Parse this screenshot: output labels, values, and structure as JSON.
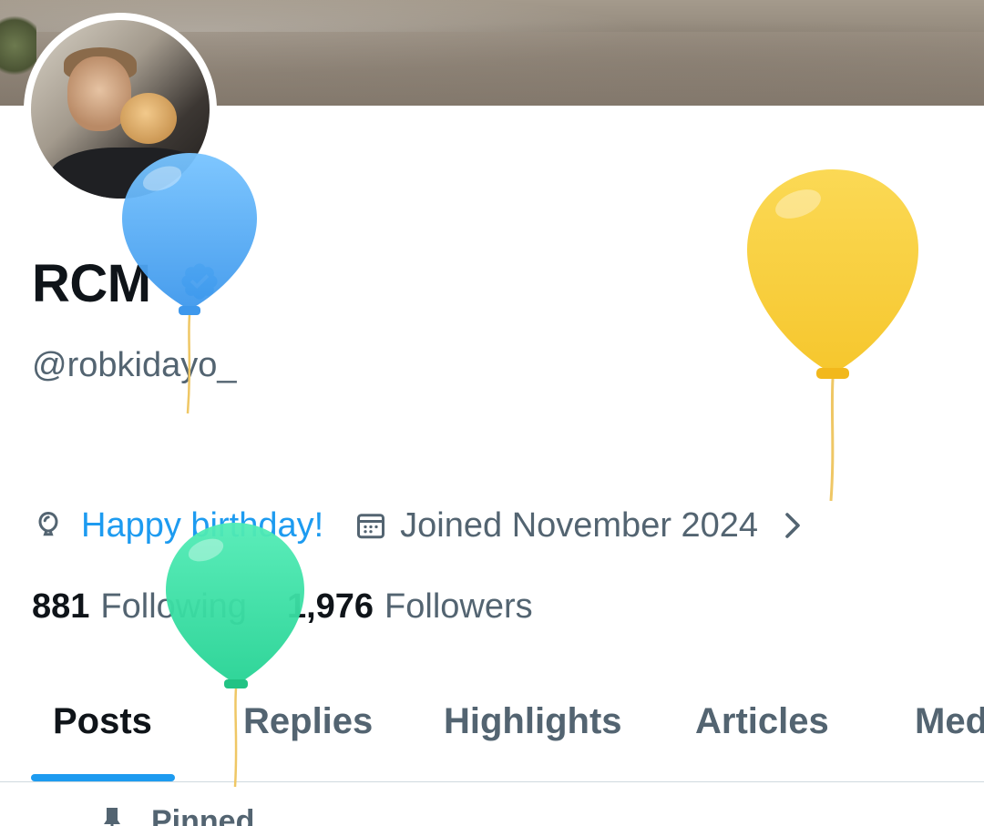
{
  "profile": {
    "display_name": "RCM",
    "handle": "@robkidayo_",
    "verified_icon": "verified-badge-icon",
    "birthday_text": "Happy birthday!",
    "joined_text": "Joined November 2024",
    "following_count": "881",
    "following_label": "Following",
    "followers_count": "1,976",
    "followers_label": "Followers"
  },
  "tabs": [
    {
      "label": "Posts",
      "active": true
    },
    {
      "label": "Replies",
      "active": false
    },
    {
      "label": "Highlights",
      "active": false
    },
    {
      "label": "Articles",
      "active": false
    },
    {
      "label": "Med",
      "active": false
    }
  ],
  "pinned_label": "Pinned",
  "colors": {
    "accent": "#1d9bf0",
    "text_primary": "#0f1419",
    "text_secondary": "#536471",
    "balloon_blue": "#5cb3f5",
    "balloon_yellow": "#f9d443",
    "balloon_green": "#3ee0a6"
  },
  "icons": {
    "balloon": "balloon-icon",
    "calendar": "calendar-icon",
    "chevron": "chevron-right-icon",
    "pin": "pin-icon"
  }
}
